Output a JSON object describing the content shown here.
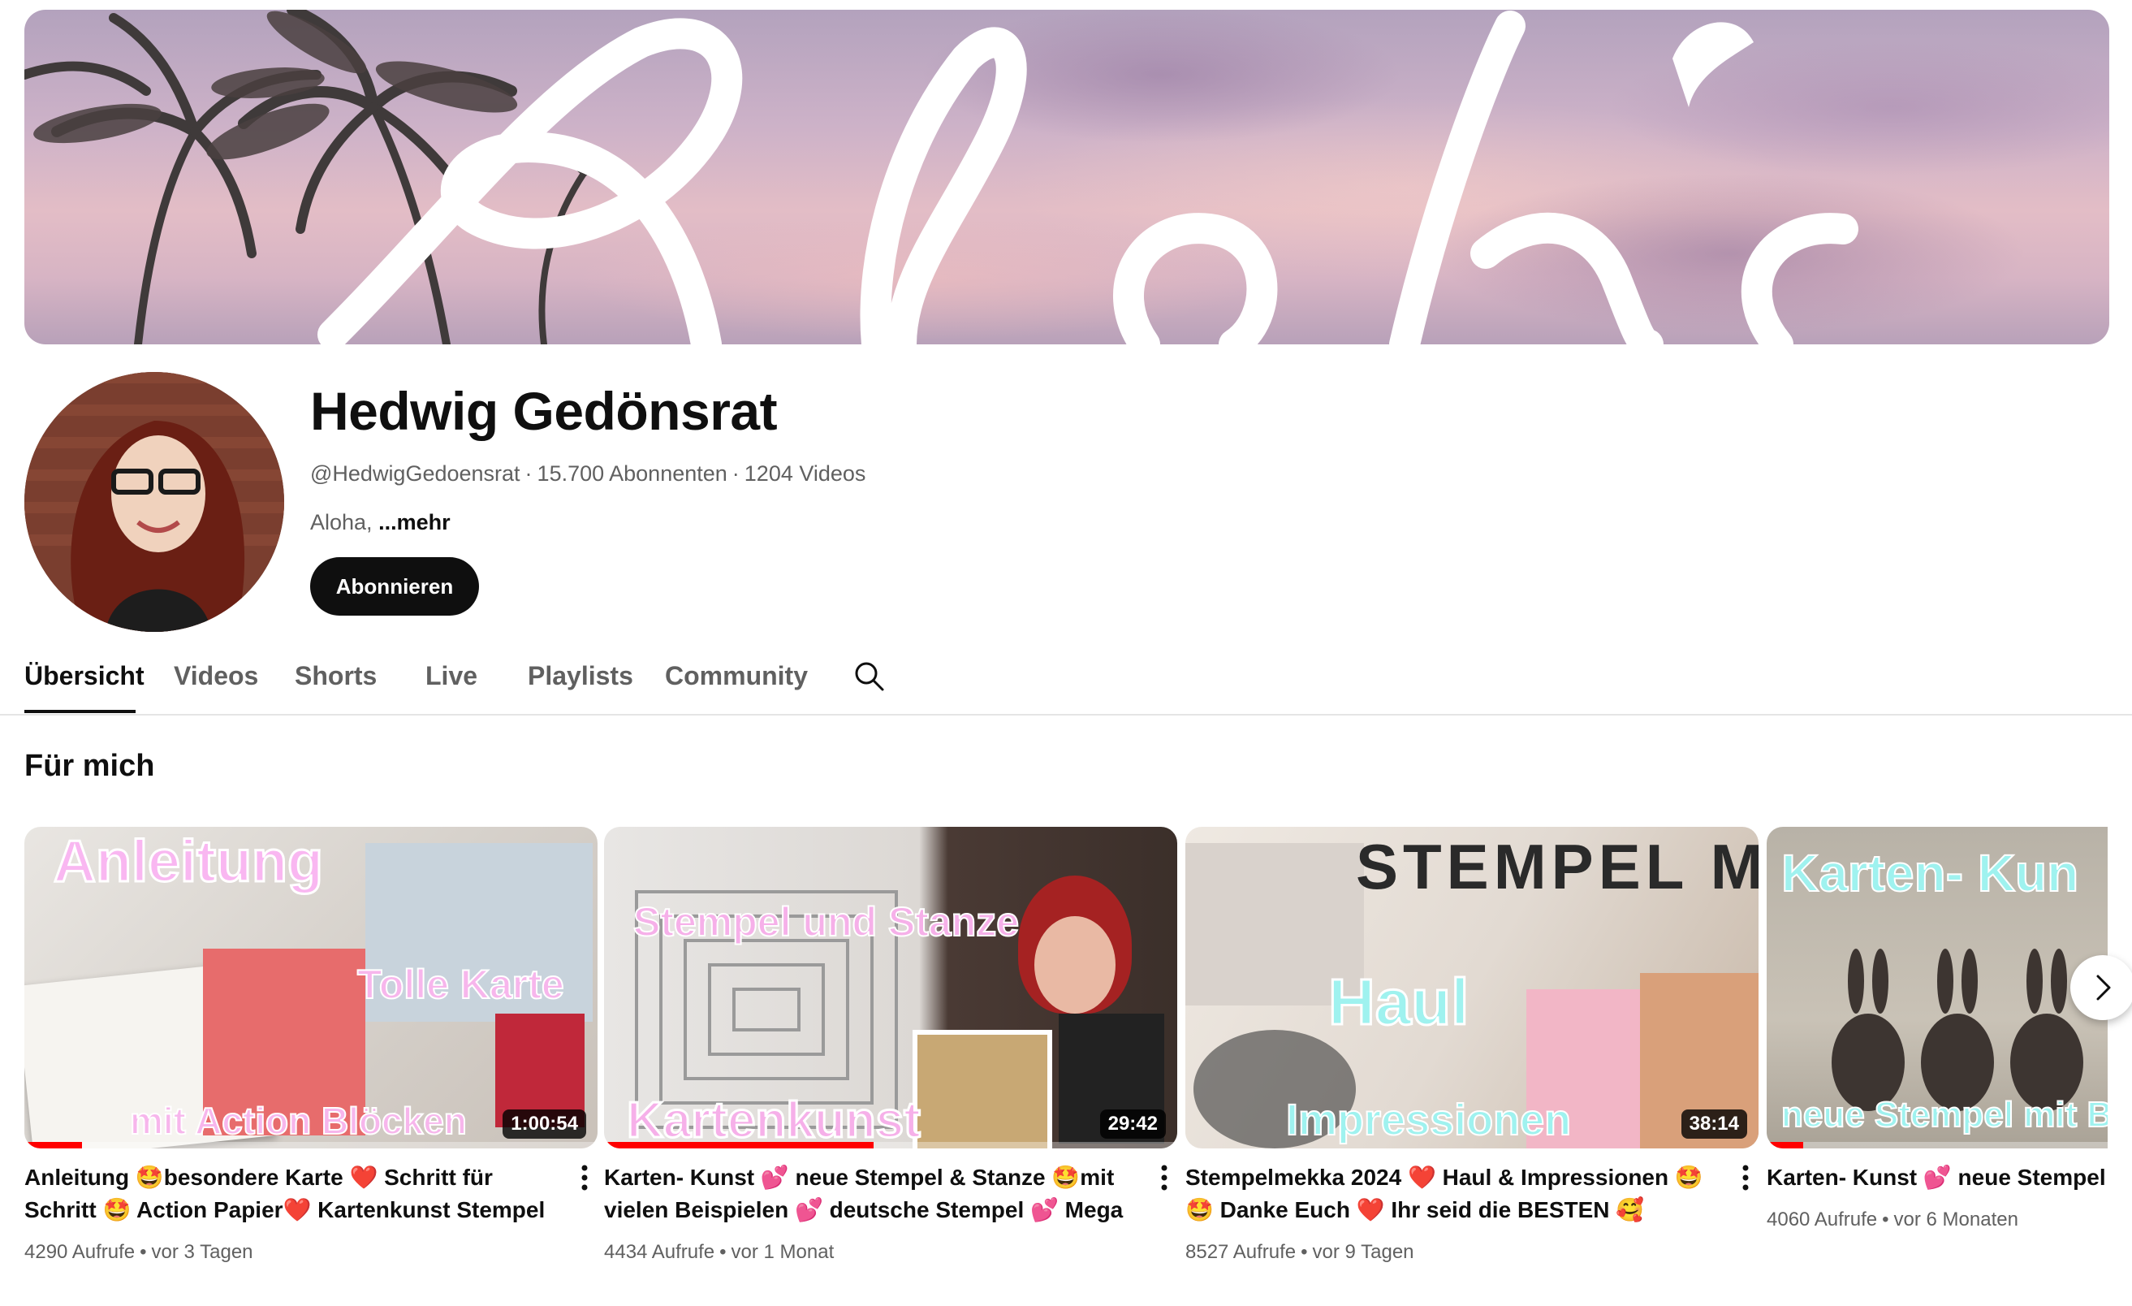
{
  "channel": {
    "name": "Hedwig Gedönsrat",
    "handle": "@HedwigGedoensrat",
    "subscribers": "15.700 Abonnenten",
    "videos_count": "1204 Videos",
    "separator": "·",
    "description": "Aloha,",
    "more_label": "...mehr",
    "subscribe_label": "Abonnieren"
  },
  "tabs": [
    {
      "label": "Übersicht",
      "active": true
    },
    {
      "label": "Videos",
      "active": false
    },
    {
      "label": "Shorts",
      "active": false
    },
    {
      "label": "Live",
      "active": false
    },
    {
      "label": "Playlists",
      "active": false
    },
    {
      "label": "Community",
      "active": false
    }
  ],
  "section": {
    "title": "Für mich"
  },
  "videos": [
    {
      "title": "Anleitung 🤩besondere Karte ❤️ Schritt für Schritt 🤩 Action Papier❤️ Kartenkunst Stempel 💕",
      "views": "4290 Aufrufe",
      "age": "vor 3 Tagen",
      "duration": "1:00:54",
      "progress": 0.1,
      "overlay_top": "Anleitung",
      "overlay_mid": "Tolle Karte",
      "overlay_bottom": "mit Action Blöcken"
    },
    {
      "title": "Karten- Kunst 💕 neue Stempel & Stanze 🤩mit vielen Beispielen 💕 deutsche Stempel 💕 Mega🤩",
      "views": "4434 Aufrufe",
      "age": "vor 1 Monat",
      "duration": "29:42",
      "progress": 0.47,
      "overlay_top": "Stempel und Stanze",
      "overlay_bottom": "Kartenkunst"
    },
    {
      "title": "Stempelmekka 2024 ❤️ Haul & Impressionen 🤩 🤩 Danke Euch ❤️ Ihr seid die BESTEN 🥰",
      "views": "8527 Aufrufe",
      "age": "vor 9 Tagen",
      "duration": "38:14",
      "progress": 0,
      "overlay_top": "Haul",
      "overlay_bottom": "Impressionen",
      "overlay_extra": "STEMPEL MEKKA"
    },
    {
      "title": "Karten- Kunst 💕 neue Stempel 🤩 Beispielen 💕 deutsche Stempel 💕",
      "views": "4060 Aufrufe",
      "age": "vor 6 Monaten",
      "duration": "",
      "progress": 0.1,
      "overlay_top": "Karten- Kun",
      "overlay_bottom": "neue Stempel mit B"
    }
  ],
  "icons": [
    "search-icon",
    "more-vert-icon",
    "chevron-right-icon"
  ],
  "colors": {
    "accent": "#ff0000",
    "text": "#0f0f0f",
    "secondary": "#606060",
    "button": "#0f0f0f"
  }
}
